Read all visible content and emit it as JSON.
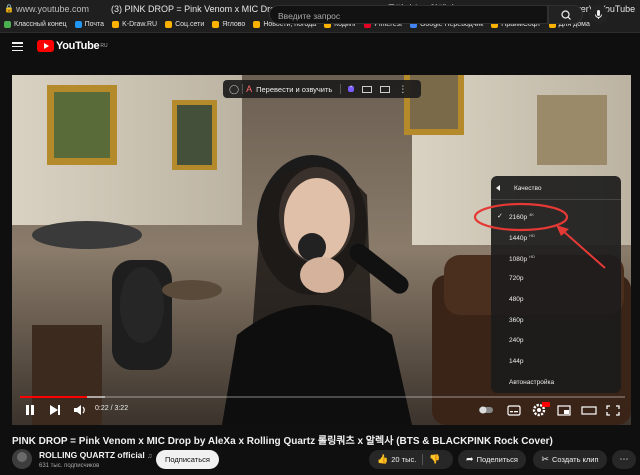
{
  "browser": {
    "url": "www.youtube.com",
    "tab_title": "(3) PINK DROP = Pink Venom x MIC Drop by AleXa x Rolling Quartz 롤링쿼츠 x 알렉사 (BTS & BLACKPINK Rock Cover) - YouTube",
    "bookmarks": [
      {
        "label": "Классный конец",
        "color": "#4caf50"
      },
      {
        "label": "Почта",
        "color": "#2196f3"
      },
      {
        "label": "K-Draw.RU",
        "color": "#ffb300"
      },
      {
        "label": "Соц.сети",
        "color": "#ffb300"
      },
      {
        "label": "Яглово",
        "color": "#ffb300"
      },
      {
        "label": "Новости, погода",
        "color": "#ffb300"
      },
      {
        "label": "Кодинг",
        "color": "#ffb300"
      },
      {
        "label": "Pinterest",
        "color": "#e60023"
      },
      {
        "label": "Google Переводчик",
        "color": "#4285f4"
      },
      {
        "label": "ПраймСофт",
        "color": "#ffb300"
      },
      {
        "label": "Для дома",
        "color": "#ffb300"
      }
    ]
  },
  "header": {
    "logo_text": "YouTube",
    "logo_region": "RU",
    "search_placeholder": "Введите запрос"
  },
  "translate_bar": {
    "label": "Перевести и озвучить"
  },
  "quality_menu": {
    "title": "Качество",
    "items": [
      {
        "label": "2160p",
        "badge": "4K",
        "selected": true
      },
      {
        "label": "1440p",
        "badge": "HD",
        "selected": false
      },
      {
        "label": "1080p",
        "badge": "HD",
        "selected": false
      },
      {
        "label": "720p",
        "badge": "",
        "selected": false
      },
      {
        "label": "480p",
        "badge": "",
        "selected": false
      },
      {
        "label": "360p",
        "badge": "",
        "selected": false
      },
      {
        "label": "240p",
        "badge": "",
        "selected": false
      },
      {
        "label": "144p",
        "badge": "",
        "selected": false
      },
      {
        "label": "Автонастройка",
        "badge": "",
        "selected": false
      }
    ]
  },
  "player": {
    "time": "0:22 / 3:22",
    "progress_fraction": 0.11,
    "buffered_fraction": 0.14,
    "accent_color": "#ff0000",
    "annotation_color": "#e53935"
  },
  "video_info": {
    "title": "PINK DROP = Pink Venom x MIC Drop by AleXa x Rolling Quartz 롤링쿼츠 x 알렉사 (BTS & BLACKPINK Rock Cover)",
    "channel": "ROLLING QUARTZ official",
    "subscribers": "631 тыс. подписчиков",
    "subscribe_label": "Подписаться",
    "likes": "20 тыс.",
    "share_label": "Поделиться",
    "clip_label": "Создать клип"
  }
}
